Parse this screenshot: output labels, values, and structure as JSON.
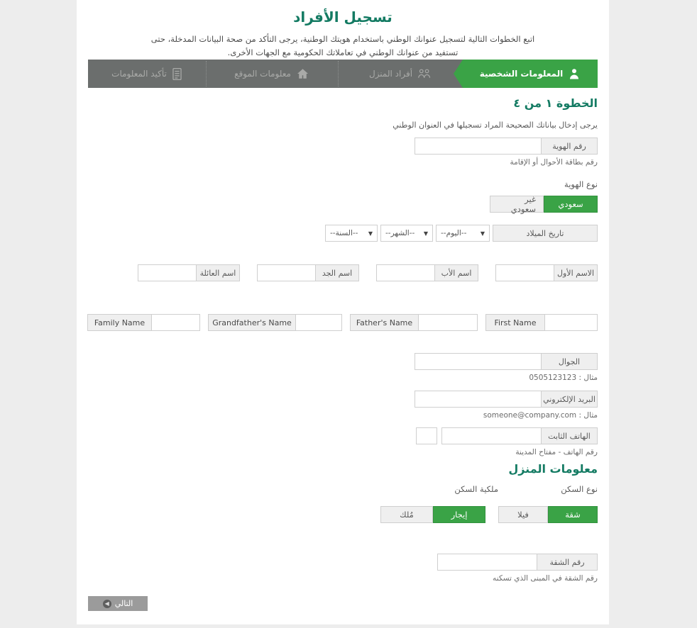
{
  "header": {
    "title": "تسجيل الأفراد",
    "tagline": "اتبع الخطوات التالية لتسجيل عنوانك الوطني باستخدام هويتك الوطنية، يرجى التأكد من صحة البيانات المدخلة، حتى تستفيد من عنوانك الوطني في تعاملاتك الحكومية مع الجهات الأخرى."
  },
  "colors": {
    "green": "#3aa346",
    "teal_heading": "#147b63",
    "gray_bar": "#6b6e6d",
    "page_bg": "#ededed",
    "field_label_bg": "#efefef",
    "next_button": "#9b9b9b"
  },
  "steps": [
    {
      "label": "المعلومات الشخصية",
      "icon": "person-icon",
      "active": true
    },
    {
      "label": "أفراد المنزل",
      "icon": "group-icon",
      "active": false
    },
    {
      "label": "معلومات الموقع",
      "icon": "home-icon",
      "active": false
    },
    {
      "label": "تأكيد المعلومات",
      "icon": "document-icon",
      "active": false
    }
  ],
  "step_progress": {
    "heading": "الخطوة ١ من ٤",
    "subheading": "يرجى إدخال بياناتك الصحيحة المراد تسجيلها في العنوان الوطني"
  },
  "identity": {
    "id_number": {
      "label": "رقم الهوية",
      "value": "",
      "hint": "رقم بطاقة الأحوال أو الإقامة"
    },
    "id_type": {
      "label": "نوع الهوية",
      "options": [
        {
          "label": "سعودي",
          "selected": true
        },
        {
          "label": "غير سعودي",
          "selected": false
        }
      ]
    },
    "birth_date": {
      "label": "تاريخ الميلاد",
      "day": "--اليوم--",
      "month": "--الشهر--",
      "year": "--السنة--"
    }
  },
  "names_ar": [
    {
      "label": "الاسم الأول",
      "value": ""
    },
    {
      "label": "اسم الأب",
      "value": ""
    },
    {
      "label": "اسم الجد",
      "value": ""
    },
    {
      "label": "اسم العائلة",
      "value": ""
    }
  ],
  "names_en": [
    {
      "label": "First Name",
      "value": ""
    },
    {
      "label": "Father's Name",
      "value": ""
    },
    {
      "label": "Grandfather's Name",
      "value": ""
    },
    {
      "label": "Family Name",
      "value": ""
    }
  ],
  "contact": {
    "mobile": {
      "label": "الجوال",
      "value": "",
      "hint": "مثال : 0505123123"
    },
    "email": {
      "label": "البريد الإلكتروني",
      "value": "",
      "hint": "مثال : someone@company.com"
    },
    "landline": {
      "label": "الهاتف الثابت",
      "value": "",
      "area_code": "",
      "hint": "رقم الهاتف - مفتاح المدينة"
    }
  },
  "home_info": {
    "heading": "معلومات المنزل",
    "housing_type": {
      "label": "نوع السكن",
      "options": [
        {
          "label": "شقة",
          "selected": true
        },
        {
          "label": "فيلا",
          "selected": false
        }
      ]
    },
    "ownership": {
      "label": "ملكية السكن",
      "options": [
        {
          "label": "إيجار",
          "selected": true
        },
        {
          "label": "مُلك",
          "selected": false
        }
      ]
    },
    "apartment_number": {
      "label": "رقم الشقة",
      "value": "",
      "hint": "رقم الشقة في المبنى الذي تسكنه"
    }
  },
  "footer": {
    "next_label": "التالي",
    "next_icon": "arrow-left-circle-icon"
  }
}
